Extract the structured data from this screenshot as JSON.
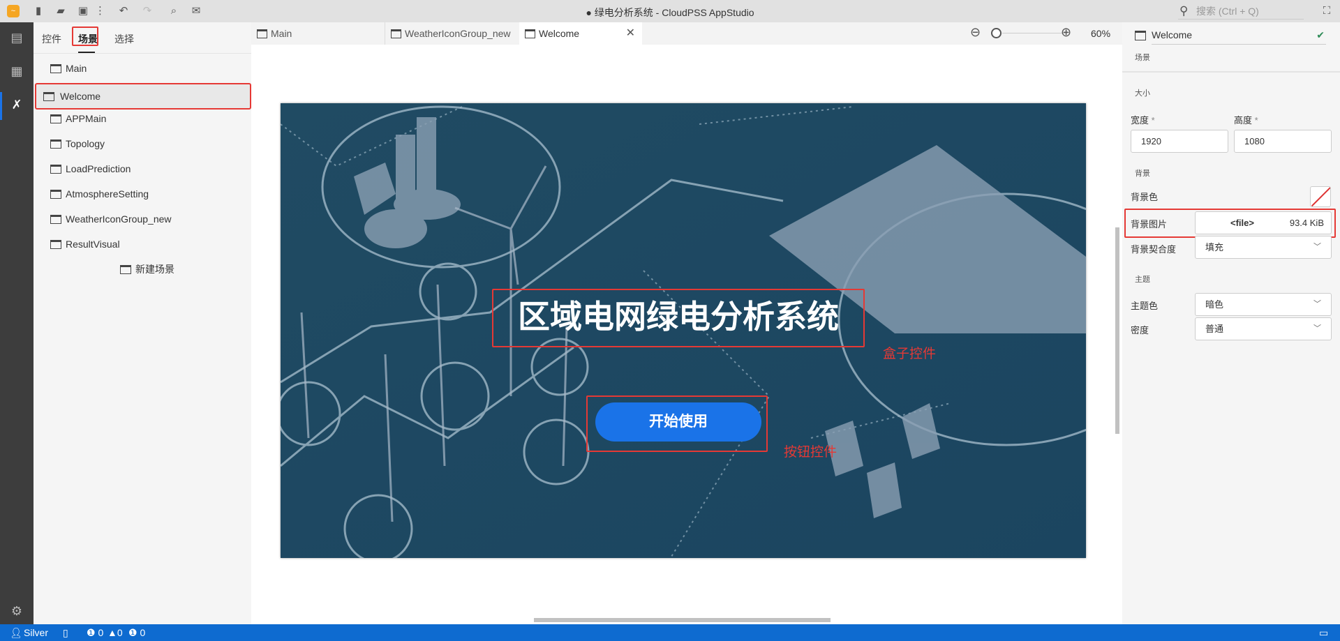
{
  "window": {
    "title": "● 绿电分析系统 - CloudPSS AppStudio",
    "search_placeholder": "搜索 (Ctrl + Q)"
  },
  "toolbar": {
    "icons": [
      "app-logo-icon",
      "new-file-icon",
      "open-folder-icon",
      "save-icon",
      "more-icon",
      "undo-icon",
      "redo-icon",
      "preview-icon",
      "publish-icon"
    ]
  },
  "left_panel": {
    "tabs": [
      {
        "label": "控件"
      },
      {
        "label": "场景",
        "active": true
      },
      {
        "label": "选择"
      }
    ],
    "scenes": [
      {
        "label": "Main"
      },
      {
        "label": "Welcome",
        "selected": true
      },
      {
        "label": "APPMain"
      },
      {
        "label": "Topology"
      },
      {
        "label": "LoadPrediction"
      },
      {
        "label": "AtmosphereSetting"
      },
      {
        "label": "WeatherIconGroup_new"
      },
      {
        "label": "ResultVisual"
      }
    ],
    "new_scene": "新建场景"
  },
  "editor": {
    "tabs": [
      {
        "label": "Main"
      },
      {
        "label": "WeatherIconGroup_new"
      },
      {
        "label": "Welcome",
        "active": true
      }
    ],
    "zoom_label": "60%",
    "zoom_value": 60,
    "scene": {
      "title": "区域电网绿电分析系统",
      "button": "开始使用",
      "button_color": "#1a73e8"
    },
    "annotations": {
      "box": "盒子控件",
      "button": "按钮控件"
    }
  },
  "properties": {
    "name": "Welcome",
    "type": "场景",
    "size_section": "大小",
    "width_label": "宽度",
    "height_label": "高度",
    "required": "*",
    "width": "1920",
    "height": "1080",
    "bg_section": "背景",
    "bg_color_label": "背景色",
    "bg_image_label": "背景图片",
    "bg_image_file": "<file>",
    "bg_image_size": "93.4 KiB",
    "bg_fit_label": "背景契合度",
    "bg_fit": "填充",
    "theme_section": "主题",
    "theme_color_label": "主题色",
    "theme_color": "暗色",
    "density_label": "密度",
    "density": "普通"
  },
  "status": {
    "user": "Silver",
    "errors": "0",
    "warnings": "0",
    "infos": "0"
  }
}
